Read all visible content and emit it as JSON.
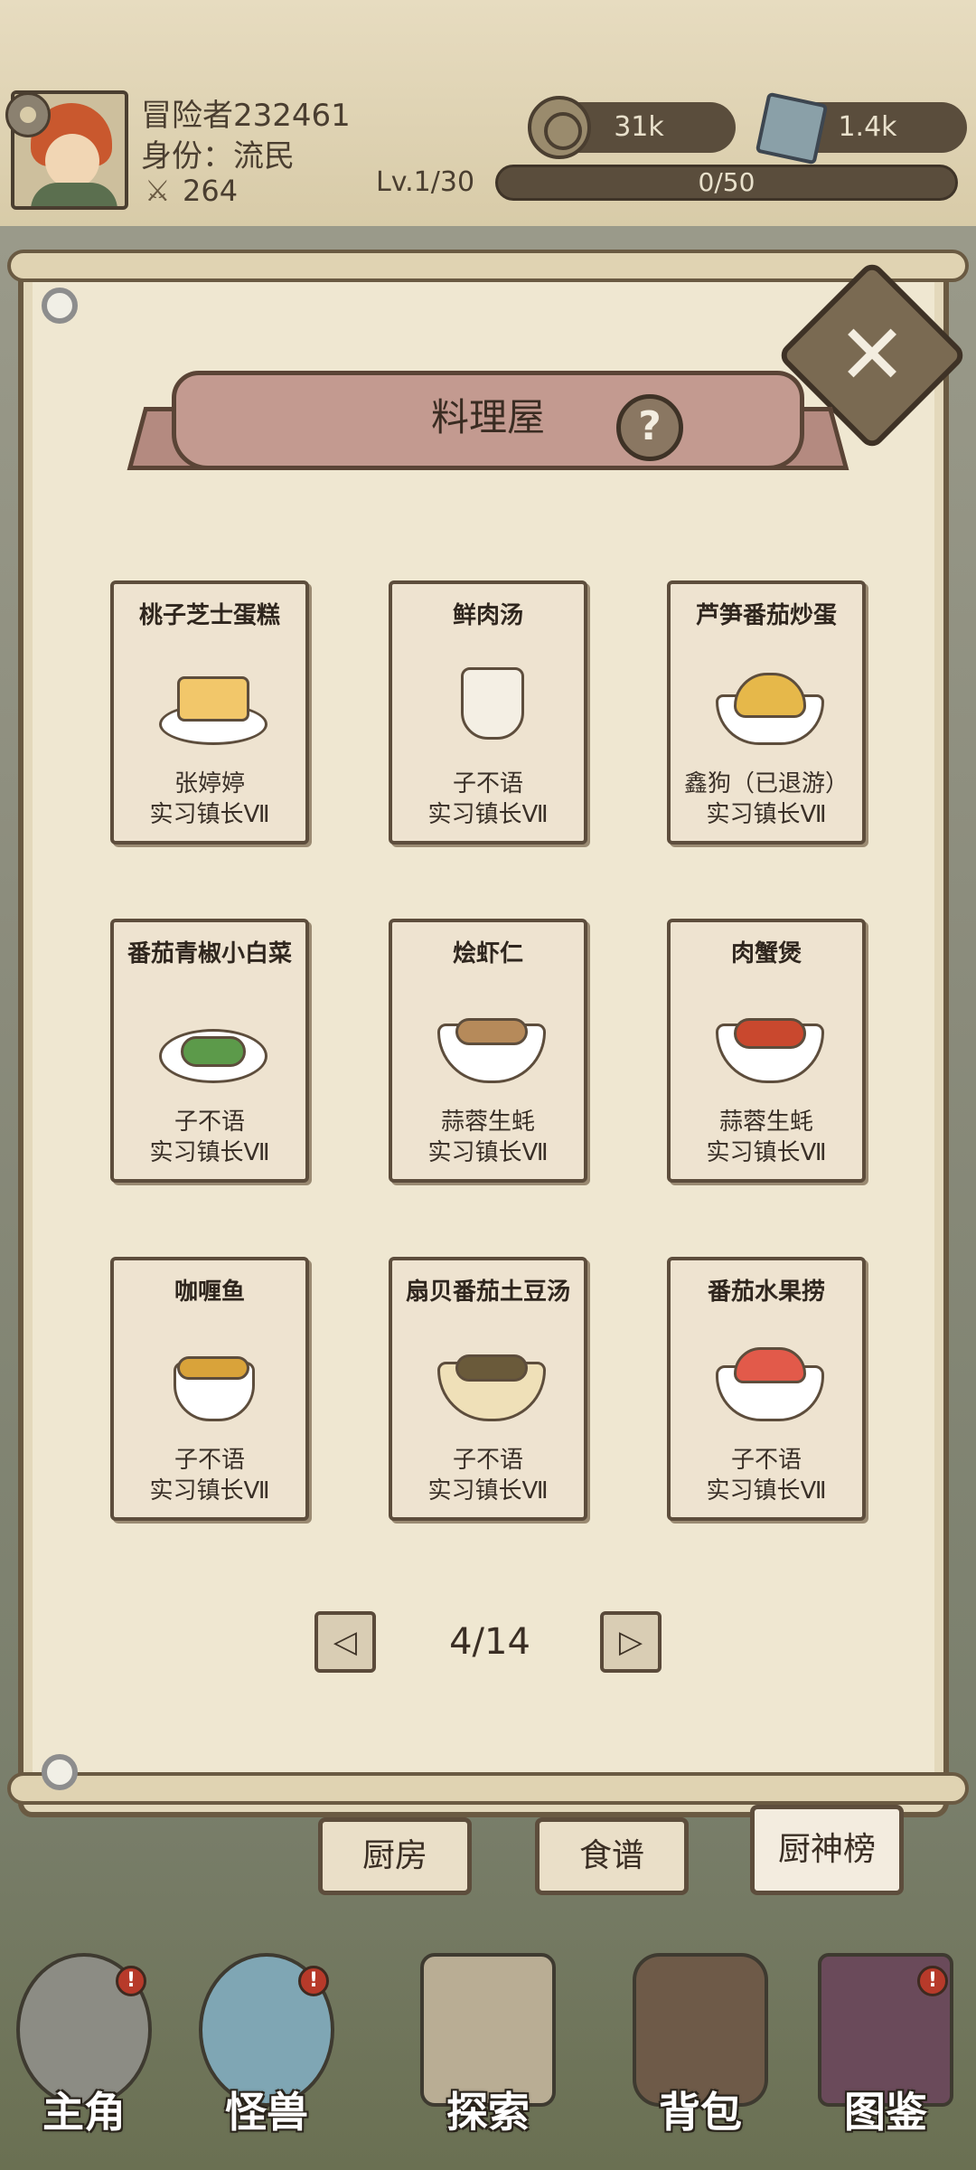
{
  "header": {
    "player_name": "冒险者232461",
    "role": "身份：流民",
    "power": "264",
    "coins": "31k",
    "gems": "1.4k",
    "level": "Lv.1/30",
    "xp": "0/50"
  },
  "panel": {
    "title": "料理屋",
    "help": "?"
  },
  "cards": [
    {
      "name": "桃子芝士蛋糕",
      "author": "张婷婷",
      "rank": "实习镇长Ⅶ"
    },
    {
      "name": "鲜肉汤",
      "author": "子不语",
      "rank": "实习镇长Ⅶ"
    },
    {
      "name": "芦笋番茄炒蛋",
      "author": "鑫狗（已退游）",
      "rank": "实习镇长Ⅶ"
    },
    {
      "name": "番茄青椒小白菜",
      "author": "子不语",
      "rank": "实习镇长Ⅶ"
    },
    {
      "name": "烩虾仁",
      "author": "蒜蓉生蚝",
      "rank": "实习镇长Ⅶ"
    },
    {
      "name": "肉蟹煲",
      "author": "蒜蓉生蚝",
      "rank": "实习镇长Ⅶ"
    },
    {
      "name": "咖喱鱼",
      "author": "子不语",
      "rank": "实习镇长Ⅶ"
    },
    {
      "name": "扇贝番茄土豆汤",
      "author": "子不语",
      "rank": "实习镇长Ⅶ"
    },
    {
      "name": "番茄水果捞",
      "author": "子不语",
      "rank": "实习镇长Ⅶ"
    }
  ],
  "pagination": {
    "current": "4/14",
    "prev": "◁",
    "next": "▷"
  },
  "tabs": [
    "厨房",
    "食谱",
    "厨神榜"
  ],
  "nav": [
    {
      "label": "主角",
      "badge": "!"
    },
    {
      "label": "怪兽",
      "badge": "!"
    },
    {
      "label": "探索"
    },
    {
      "label": "背包"
    },
    {
      "label": "图鉴",
      "badge": "!"
    }
  ],
  "colors": {
    "panel_bg": "#efe7d1",
    "border": "#6a5a42",
    "banner": "#c39a90",
    "badge": "#b73a2a"
  },
  "icons": {
    "close": "close-icon",
    "help": "help-icon",
    "coin": "coin-icon",
    "gem": "gem-icon",
    "settings": "gear-icon",
    "power": "sword-icon"
  }
}
